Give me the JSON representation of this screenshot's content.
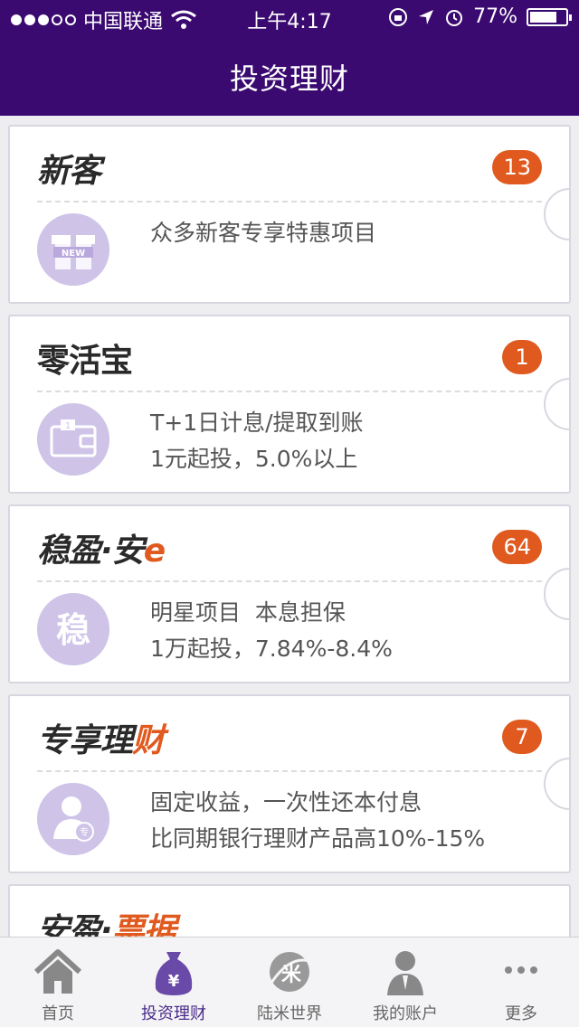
{
  "status_bar": {
    "carrier": "中国联通",
    "time": "上午4:17",
    "battery": "77%",
    "battery_level": 0.77
  },
  "header": {
    "title": "投资理财"
  },
  "cards": [
    {
      "title_main": "新客",
      "title_accent": "",
      "badge": "13",
      "icon": "new-gift-icon",
      "lines": [
        "众多新客专享特惠项目"
      ]
    },
    {
      "title_main": "零活宝",
      "title_accent": "",
      "badge": "1",
      "icon": "wallet-icon",
      "lines": [
        "T+1日计息/提取到账",
        "1元起投，5.0%以上"
      ]
    },
    {
      "title_main": "稳盈·安",
      "title_accent": "e",
      "badge": "64",
      "icon": "wen-character-icon",
      "lines": [
        "明星项目  本息担保",
        "1万起投，7.84%-8.4%"
      ]
    },
    {
      "title_main": "专享理",
      "title_accent": "财",
      "badge": "7",
      "icon": "vip-person-icon",
      "lines": [
        "固定收益，一次性还本付息",
        "比同期银行理财产品高10%-15%"
      ]
    },
    {
      "title_main": "安盈·",
      "title_accent": "票据",
      "badge": "",
      "icon": "",
      "lines": []
    }
  ],
  "tabbar": {
    "items": [
      {
        "label": "首页",
        "icon": "home-icon"
      },
      {
        "label": "投资理财",
        "icon": "money-bag-icon"
      },
      {
        "label": "陆米世界",
        "icon": "lumi-icon"
      },
      {
        "label": "我的账户",
        "icon": "account-person-icon"
      },
      {
        "label": "更多",
        "icon": "more-dots-icon"
      }
    ],
    "active_index": 1
  },
  "colors": {
    "header_bg": "#3a0a70",
    "accent_orange": "#e05a1f",
    "icon_lavender": "#cfc4e8",
    "tab_active": "#4a2a8a"
  }
}
